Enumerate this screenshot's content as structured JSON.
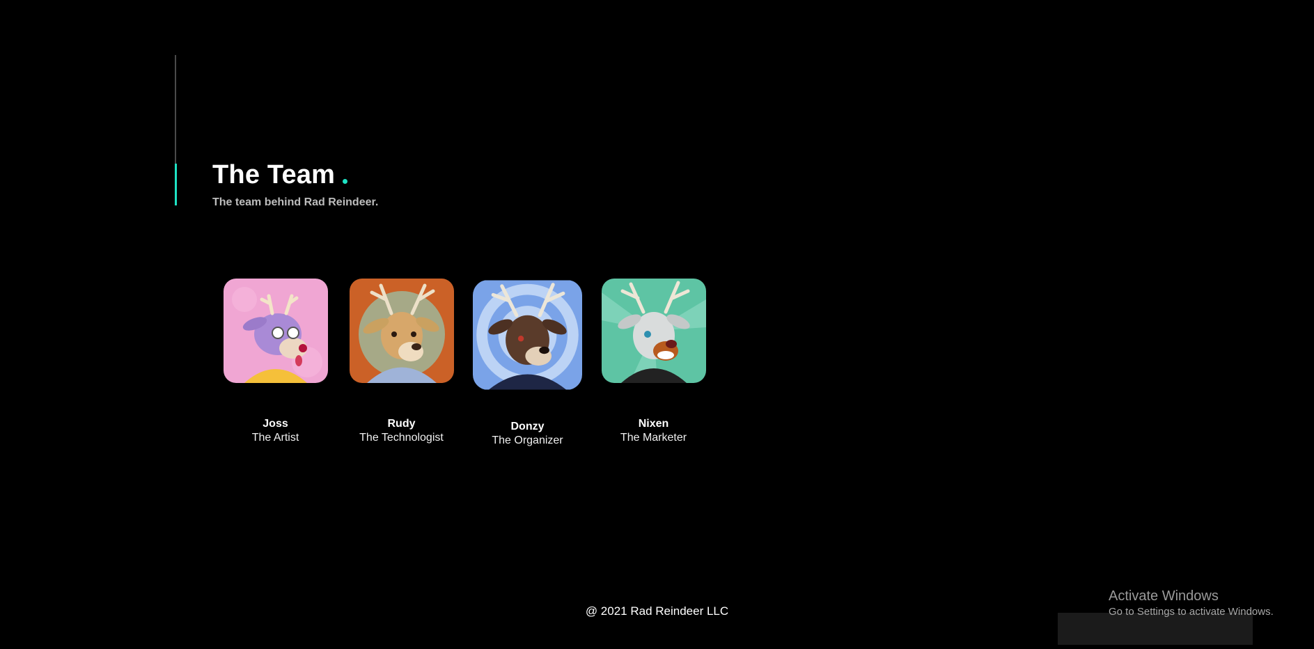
{
  "header": {
    "title": "The Team",
    "subtitle": "The team behind Rad Reindeer."
  },
  "members": [
    {
      "name": "Joss",
      "role": "The Artist"
    },
    {
      "name": "Rudy",
      "role": "The Technologist"
    },
    {
      "name": "Donzy",
      "role": "The Organizer"
    },
    {
      "name": "Nixen",
      "role": "The Marketer"
    }
  ],
  "footer": {
    "copyright": "@ 2021 Rad Reindeer LLC"
  },
  "watermark": {
    "title": "Activate Windows",
    "subtitle": "Go to Settings to activate Windows."
  },
  "colors": {
    "accent": "#1ee3c4",
    "background": "#000000"
  }
}
